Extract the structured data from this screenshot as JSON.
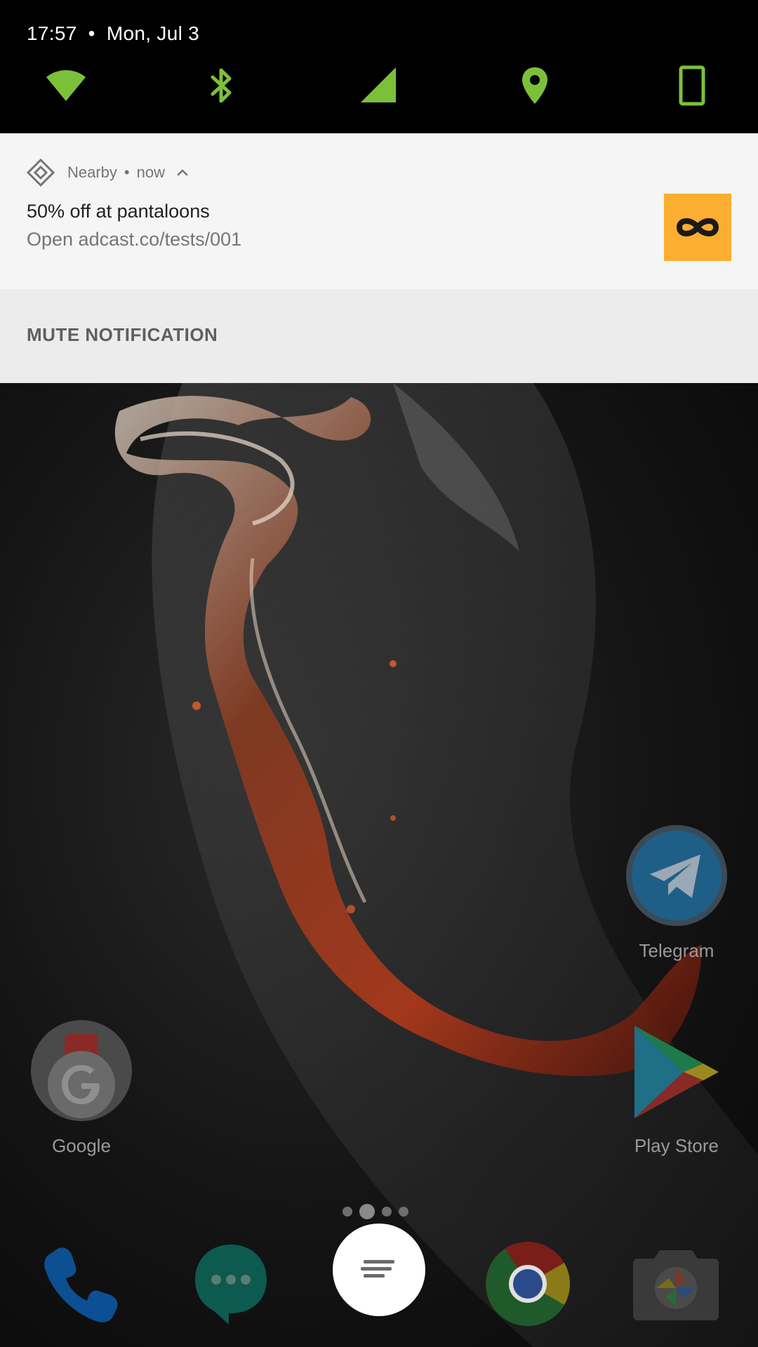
{
  "status_bar": {
    "time": "17:57",
    "separator": "•",
    "date": "Mon, Jul 3"
  },
  "quick_settings": [
    {
      "name": "wifi",
      "icon": "wifi-icon"
    },
    {
      "name": "bluetooth",
      "icon": "bluetooth-icon"
    },
    {
      "name": "cellular",
      "icon": "cellular-signal-icon"
    },
    {
      "name": "location",
      "icon": "location-pin-icon"
    },
    {
      "name": "rotation",
      "icon": "phone-portrait-icon"
    }
  ],
  "quick_settings_color": "#7cc03a",
  "notification": {
    "app_icon": "nearby-diamond-icon",
    "app_name": "Nearby",
    "separator": "•",
    "time": "now",
    "expand_icon": "chevron-up-icon",
    "title": "50% off at pantaloons",
    "text": "Open adcast.co/tests/001",
    "image_icon": "infinity-icon",
    "image_background": "#fbae2f",
    "action": "MUTE NOTIFICATION"
  },
  "home": {
    "apps": [
      {
        "label": "Telegram",
        "icon": "telegram-icon"
      },
      {
        "label": "Google",
        "icon": "google-folder-icon"
      },
      {
        "label": "Play Store",
        "icon": "play-store-icon"
      }
    ],
    "page_indicator": {
      "pages": 4,
      "current": 2
    },
    "dock": [
      {
        "icon": "phone-icon"
      },
      {
        "icon": "messages-icon"
      },
      {
        "icon": "app-drawer-icon"
      },
      {
        "icon": "chrome-icon"
      },
      {
        "icon": "camera-icon"
      }
    ]
  }
}
